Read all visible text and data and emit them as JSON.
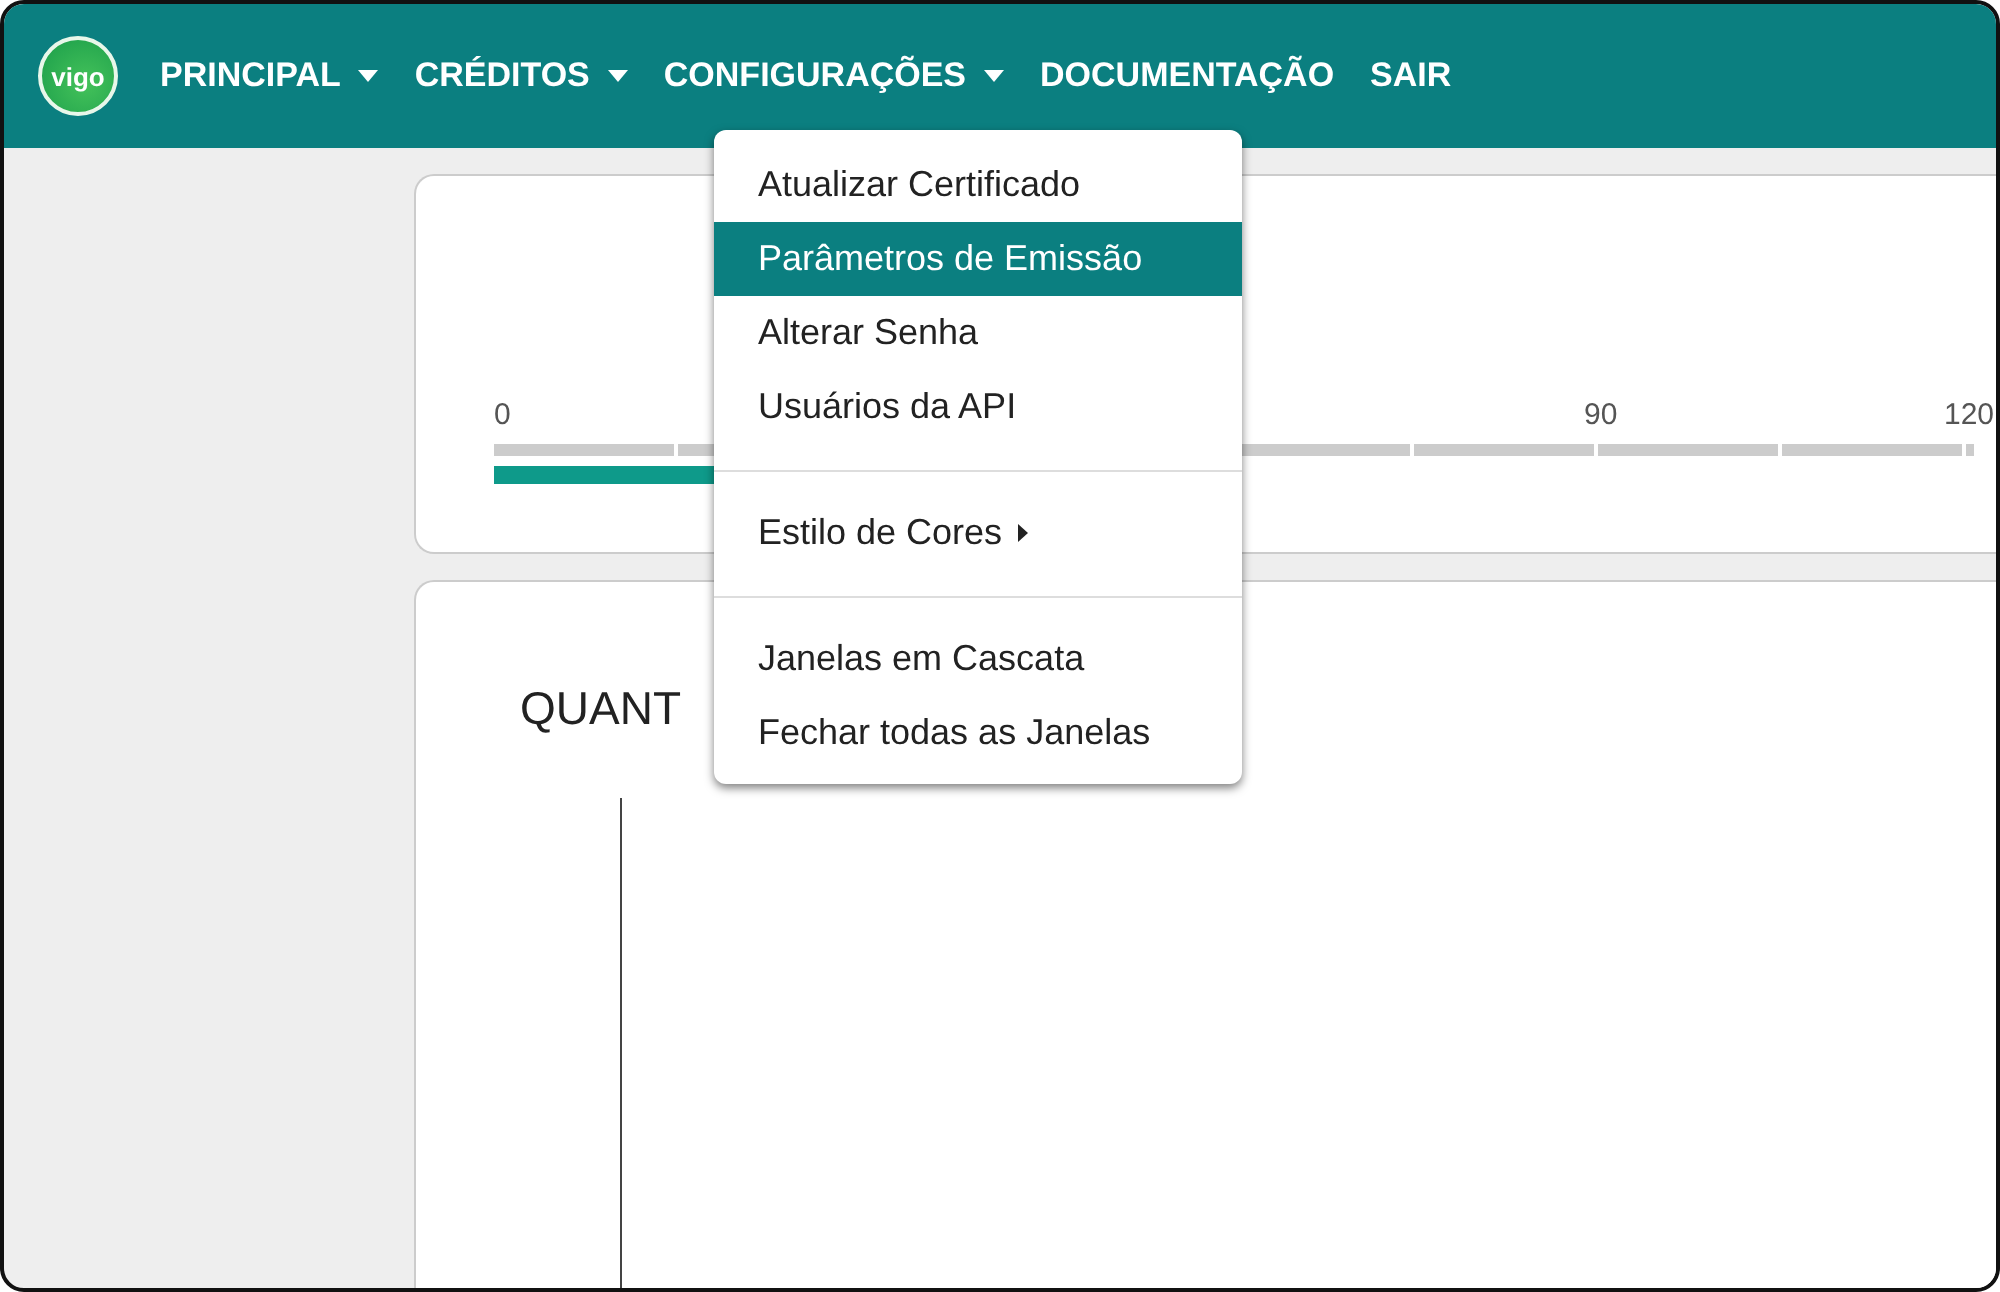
{
  "logo": {
    "text": "vigo"
  },
  "nav": [
    {
      "label": "PRINCIPAL",
      "dropdown": true,
      "expanded": false
    },
    {
      "label": "CRÉDITOS",
      "dropdown": true,
      "expanded": false
    },
    {
      "label": "CONFIGURAÇÕES",
      "dropdown": true,
      "expanded": true
    },
    {
      "label": "DOCUMENTAÇÃO",
      "dropdown": false,
      "expanded": false
    },
    {
      "label": "SAIR",
      "dropdown": false,
      "expanded": false
    }
  ],
  "menu": {
    "groups": [
      [
        {
          "label": "Atualizar Certificado",
          "selected": false,
          "submenu": false
        },
        {
          "label": "Parâmetros de Emissão",
          "selected": true,
          "submenu": false
        },
        {
          "label": "Alterar Senha",
          "selected": false,
          "submenu": false
        },
        {
          "label": "Usuários da API",
          "selected": false,
          "submenu": false
        }
      ],
      [
        {
          "label": "Estilo de Cores",
          "selected": false,
          "submenu": true
        }
      ],
      [
        {
          "label": "Janelas em Cascata",
          "selected": false,
          "submenu": false
        },
        {
          "label": "Fechar todas as Janelas",
          "selected": false,
          "submenu": false
        }
      ]
    ]
  },
  "scale_card": {
    "labels": [
      "0",
      "90",
      "120"
    ],
    "level": 0.15
  },
  "chart_card": {
    "title": "QUANT"
  }
}
